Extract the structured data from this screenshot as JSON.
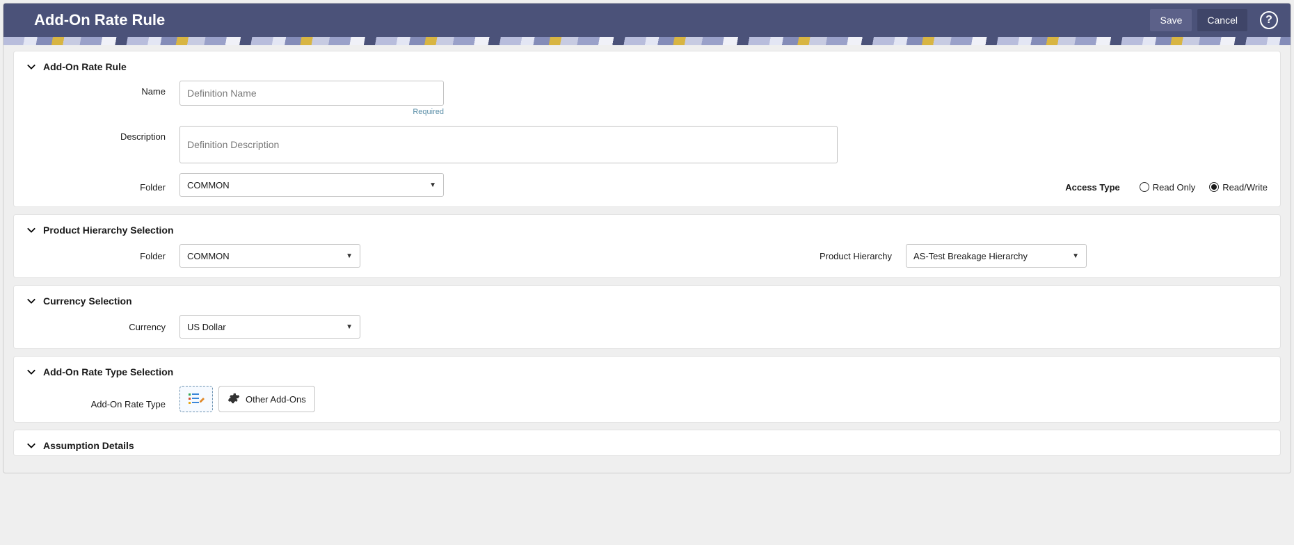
{
  "header": {
    "title": "Add-On Rate Rule",
    "save_label": "Save",
    "cancel_label": "Cancel"
  },
  "sections": {
    "rule": {
      "title": "Add-On Rate Rule",
      "name_label": "Name",
      "name_placeholder": "Definition Name",
      "name_value": "",
      "name_hint": "Required",
      "description_label": "Description",
      "description_placeholder": "Definition Description",
      "description_value": "",
      "folder_label": "Folder",
      "folder_value": "COMMON",
      "access_type_label": "Access Type",
      "access_read_only_label": "Read Only",
      "access_read_write_label": "Read/Write",
      "access_selected": "read_write"
    },
    "product_hierarchy": {
      "title": "Product Hierarchy Selection",
      "folder_label": "Folder",
      "folder_value": "COMMON",
      "hierarchy_label": "Product Hierarchy",
      "hierarchy_value": "AS-Test Breakage Hierarchy"
    },
    "currency": {
      "title": "Currency Selection",
      "currency_label": "Currency",
      "currency_value": "US Dollar"
    },
    "rate_type": {
      "title": "Add-On Rate Type Selection",
      "rate_type_label": "Add-On Rate Type",
      "other_addons_label": "Other Add-Ons"
    },
    "assumption": {
      "title": "Assumption Details"
    }
  }
}
